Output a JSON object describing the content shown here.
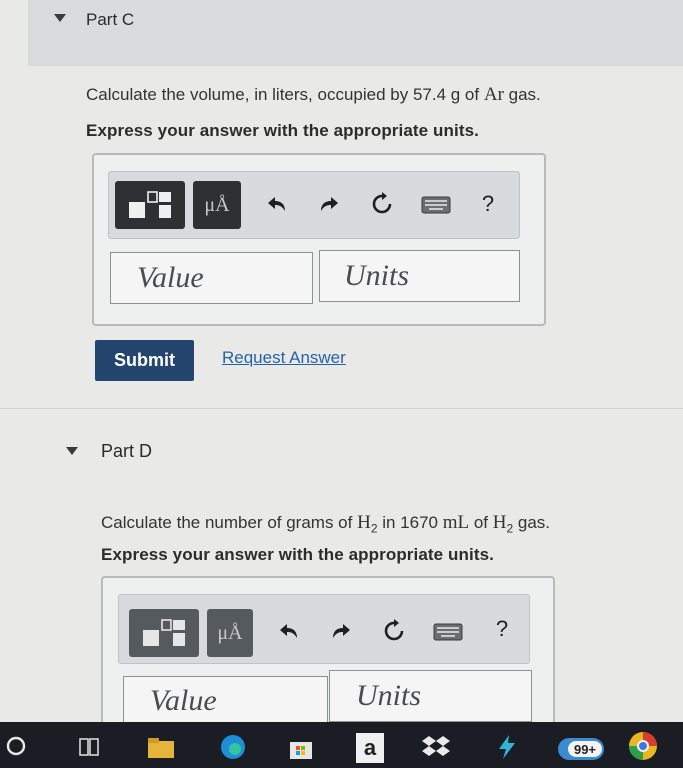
{
  "part_c": {
    "title": "Part C",
    "question": {
      "prefix": "Calculate the volume, in liters, occupied by 57.4 g of ",
      "formula": "Ar",
      "suffix": " gas."
    },
    "instruction": "Express your answer with the appropriate units.",
    "value_placeholder": "Value",
    "units_placeholder": "Units",
    "submit_label": "Submit",
    "request_answer_label": "Request Answer"
  },
  "part_d": {
    "title": "Part D",
    "question": {
      "prefix": "Calculate the number of grams of ",
      "formula1": "H",
      "sub1": "2",
      "middle": " in 1670 ",
      "unit": "mL",
      "of_text": " of ",
      "formula2": "H",
      "sub2": "2",
      "suffix": " gas."
    },
    "instruction": "Express your answer with the appropriate units.",
    "value_placeholder": "Value",
    "units_placeholder": "Units"
  },
  "toolbar": {
    "mu_label": "μÅ",
    "help_label": "?"
  },
  "taskbar": {
    "amazon_label": "a",
    "badge_label": "99+"
  },
  "colors": {
    "submit_bg": "#24466e",
    "link": "#2563a8",
    "taskbar": "#1a1d24"
  }
}
